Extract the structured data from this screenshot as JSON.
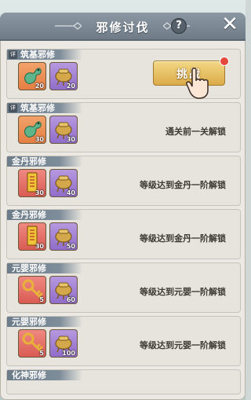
{
  "window": {
    "title": "邪修讨伐",
    "help_icon": "question-icon",
    "close_icon": "close-x-icon",
    "help_label": "?"
  },
  "cards": [
    {
      "badge": "详",
      "title": "筑基邪修",
      "items": [
        {
          "icon": "jade-dragon-icon",
          "qty": "20",
          "color": "orange"
        },
        {
          "icon": "incense-burner-icon",
          "qty": "20",
          "color": "purple"
        }
      ],
      "action": "挑战",
      "has_red_dot": true
    },
    {
      "badge": "详",
      "title": "筑基邪修",
      "items": [
        {
          "icon": "jade-dragon-icon",
          "qty": "30",
          "color": "orange"
        },
        {
          "icon": "incense-burner-icon",
          "qty": "30",
          "color": "purple"
        }
      ],
      "status": "通关前一关解锁"
    },
    {
      "title": "金丹邪修",
      "items": [
        {
          "icon": "talisman-scroll-icon",
          "qty": "30",
          "color": "red"
        },
        {
          "icon": "incense-burner-icon",
          "qty": "40",
          "color": "purple"
        }
      ],
      "status": "等级达到金丹一阶解锁"
    },
    {
      "title": "金丹邪修",
      "items": [
        {
          "icon": "talisman-scroll-icon",
          "qty": "30",
          "color": "red"
        },
        {
          "icon": "incense-burner-icon",
          "qty": "50",
          "color": "purple"
        }
      ],
      "status": "等级达到金丹一阶解锁"
    },
    {
      "title": "元婴邪修",
      "items": [
        {
          "icon": "golden-key-icon",
          "qty": "5",
          "color": "red"
        },
        {
          "icon": "incense-burner-icon",
          "qty": "60",
          "color": "purple"
        }
      ],
      "status": "等级达到元婴一阶解锁"
    },
    {
      "title": "元婴邪修",
      "items": [
        {
          "icon": "golden-key-icon",
          "qty": "5",
          "color": "red"
        },
        {
          "icon": "incense-burner-icon",
          "qty": "100",
          "color": "purple"
        }
      ],
      "status": "等级达到元婴一阶解锁"
    },
    {
      "title": "化神邪修",
      "items": []
    }
  ],
  "colors": {
    "panel": "#ece9e4",
    "header": "#6f7c88",
    "button_gold": "#dbab48"
  }
}
